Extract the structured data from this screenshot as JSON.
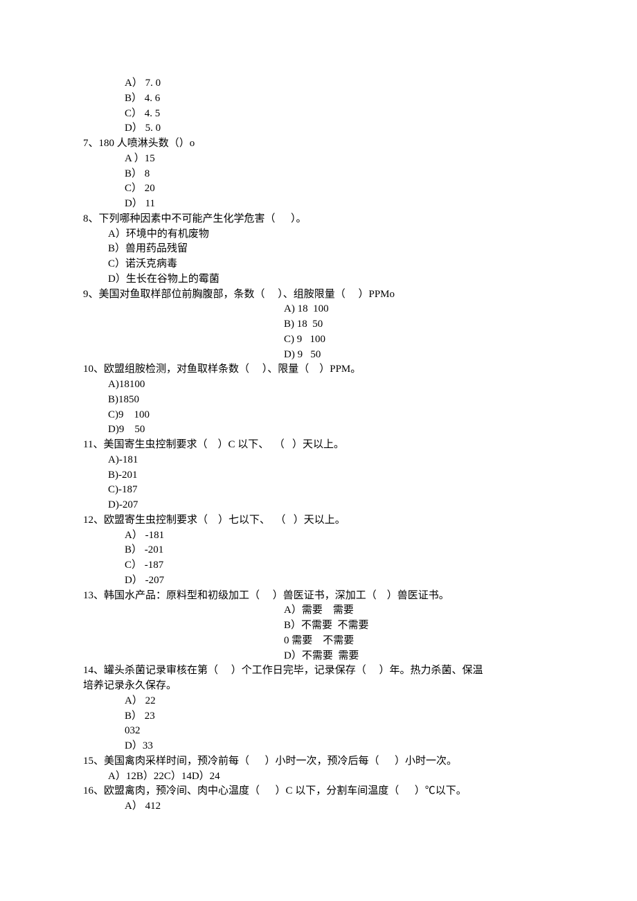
{
  "q6_opts": {
    "a": "A） 7. 0",
    "b": "B） 4. 6",
    "c": "C） 4. 5",
    "d": "D） 5. 0"
  },
  "q7": {
    "text": "7、180 人喷淋头数（）o",
    "a": "A ）15",
    "b": "B） 8",
    "c": "C） 20",
    "d": "D） 11"
  },
  "q8": {
    "text": "8、下列哪种因素中不可能产生化学危害（      ）。",
    "a": "A）环境中的有机废物",
    "b": "B）兽用药品残留",
    "c": "C）诺沃克病毒",
    "d": "D）生长在谷物上的霉菌"
  },
  "q9": {
    "text": "9、美国对鱼取样部位前胸腹部，条数（     ）、组胺限量（     ）PPMo",
    "a": "A) 18  100",
    "b": "B) 18  50",
    "c": "C) 9   100",
    "d": "D) 9   50"
  },
  "q10": {
    "text": "10、欧盟组胺检测，对鱼取样条数（     ）、限量（    ）PPM。",
    "a": "A)18100",
    "b": "B)1850",
    "c": "C)9    100",
    "d": "D)9    50"
  },
  "q11": {
    "text": "11、美国寄生虫控制要求（    ）C 以下、  （   ）天以上。",
    "a": "A)-181",
    "b": "B)-201",
    "c": "C)-187",
    "d": "D)-207"
  },
  "q12": {
    "text": "12、欧盟寄生虫控制要求（    ）七以下、  （   ）天以上。",
    "a": "A） -181",
    "b": "B） -201",
    "c": "C） -187",
    "d": "D） -207"
  },
  "q13": {
    "text": "13、韩国水产品：原料型和初级加工（     ）兽医证书，深加工（    ）兽医证书。",
    "a": "A）需要    需要",
    "b": "B）不需要  不需要",
    "c": "0 需要    不需要",
    "d": "D）不需要  需要"
  },
  "q14": {
    "text1": "14、罐头杀菌记录审核在第（     ）个工作日完毕，记录保存（     ）年。热力杀菌、保温",
    "text2": "培养记录永久保存。",
    "a": "A） 22",
    "b": "B） 23",
    "c": "032",
    "d": "D）33"
  },
  "q15": {
    "text": "15、美国禽肉采样时间，预冷前每（      ）小时一次，预冷后每（      ）小时一次。",
    "a": "A）12B）22C）14D）24"
  },
  "q16": {
    "text": "16、欧盟禽肉，预冷间、肉中心温度（      ）C 以下，分割车间温度（      ）℃以下。",
    "a": "A） 412"
  }
}
